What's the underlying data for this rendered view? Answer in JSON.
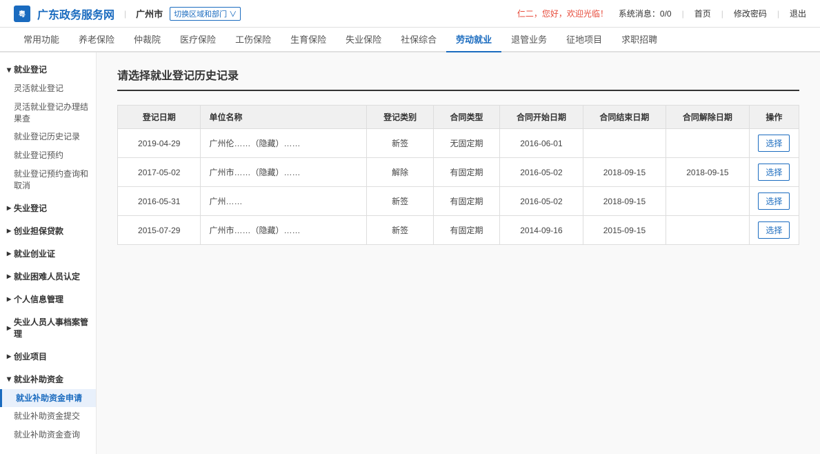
{
  "header": {
    "logo_icon": "粤",
    "logo_text": "广东政务服务网",
    "city": "广州市",
    "city_switch_label": "切换区域和部门 ∨",
    "greeting": "仁二，您好，欢迎光临！",
    "sys_msg_label": "系统消息：0/0",
    "links": [
      "首页",
      "修改密码",
      "退出"
    ]
  },
  "nav": {
    "items": [
      {
        "label": "常用功能",
        "active": false
      },
      {
        "label": "养老保险",
        "active": false
      },
      {
        "label": "仲裁院",
        "active": false
      },
      {
        "label": "医疗保险",
        "active": false
      },
      {
        "label": "工伤保险",
        "active": false
      },
      {
        "label": "生育保险",
        "active": false
      },
      {
        "label": "失业保险",
        "active": false
      },
      {
        "label": "社保综合",
        "active": false
      },
      {
        "label": "劳动就业",
        "active": true
      },
      {
        "label": "退管业务",
        "active": false
      },
      {
        "label": "征地项目",
        "active": false
      },
      {
        "label": "求职招聘",
        "active": false
      }
    ]
  },
  "sidebar": {
    "sections": [
      {
        "title": "就业登记",
        "expanded": true,
        "items": [
          {
            "label": "灵活就业登记",
            "active": false
          },
          {
            "label": "灵活就业登记办理结果查",
            "active": false
          },
          {
            "label": "就业登记历史记录",
            "active": false
          },
          {
            "label": "就业登记预约",
            "active": false
          },
          {
            "label": "就业登记预约查询和取消",
            "active": false
          }
        ]
      },
      {
        "title": "失业登记",
        "expanded": false,
        "items": []
      },
      {
        "title": "创业担保贷款",
        "expanded": false,
        "items": []
      },
      {
        "title": "就业创业证",
        "expanded": false,
        "items": []
      },
      {
        "title": "就业困难人员认定",
        "expanded": false,
        "items": []
      },
      {
        "title": "个人信息管理",
        "expanded": false,
        "items": []
      },
      {
        "title": "失业人员人事档案管理",
        "expanded": false,
        "items": []
      },
      {
        "title": "创业项目",
        "expanded": false,
        "items": []
      },
      {
        "title": "就业补助资金",
        "expanded": true,
        "items": [
          {
            "label": "就业补助资金申请",
            "active": true
          },
          {
            "label": "就业补助资金提交",
            "active": false
          },
          {
            "label": "就业补助资金查询",
            "active": false
          }
        ]
      }
    ]
  },
  "main": {
    "title": "请选择就业登记历史记录",
    "table": {
      "headers": [
        "登记日期",
        "单位名称",
        "登记类别",
        "合同类型",
        "合同开始日期",
        "合同结束日期",
        "合同解除日期",
        "操作"
      ],
      "rows": [
        {
          "date": "2019-04-29",
          "company": "广州伦……（隐藏）……",
          "reg_type": "新签",
          "contract_type": "无固定期",
          "start_date": "2016-06-01",
          "end_date": "",
          "terminate_date": "",
          "action": "选择"
        },
        {
          "date": "2017-05-02",
          "company": "广州市……（隐藏）……",
          "reg_type": "解除",
          "contract_type": "有固定期",
          "start_date": "2016-05-02",
          "end_date": "2018-09-15",
          "terminate_date": "2018-09-15",
          "action": "选择"
        },
        {
          "date": "2016-05-31",
          "company": "广州……",
          "reg_type": "新签",
          "contract_type": "有固定期",
          "start_date": "2016-05-02",
          "end_date": "2018-09-15",
          "terminate_date": "",
          "action": "选择"
        },
        {
          "date": "2015-07-29",
          "company": "广州市……（隐藏）……",
          "reg_type": "新签",
          "contract_type": "有固定期",
          "start_date": "2014-09-16",
          "end_date": "2015-09-15",
          "terminate_date": "",
          "action": "选择"
        }
      ]
    }
  },
  "colors": {
    "primary": "#1a6bbf",
    "active_nav": "#1a6bbf",
    "active_sidebar": "#1a6bbf",
    "header_bg": "#ffffff",
    "sidebar_active_bg": "#e8f0fb"
  }
}
